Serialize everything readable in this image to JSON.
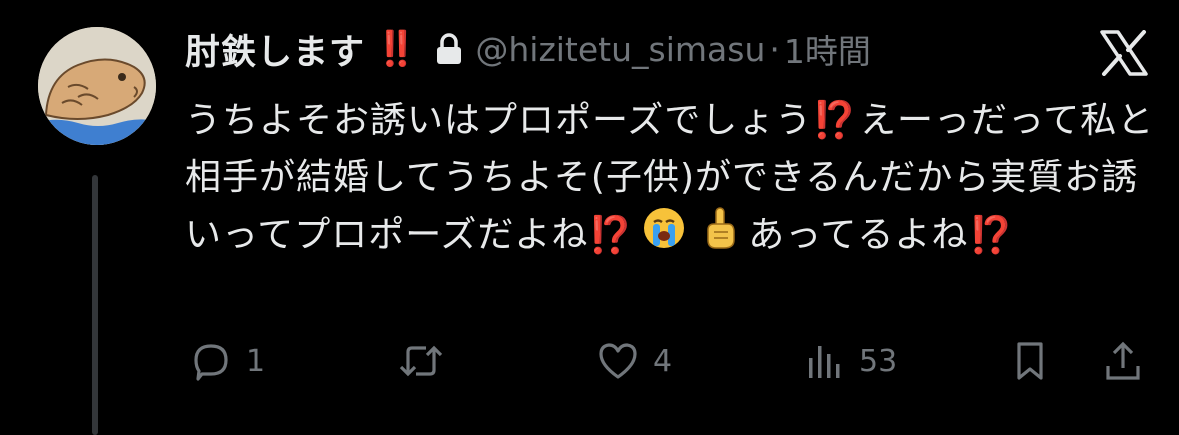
{
  "author": {
    "display_name": "肘鉄します",
    "badge": "‼️",
    "handle": "@hizitetu_simasu",
    "separator": "·",
    "time": "1時間"
  },
  "tweet": {
    "segments": [
      "うちよそお誘いはプロポーズでしょう",
      "⁉️",
      "えーっだって私と相手が結婚してうちよそ(子供)ができるんだから実質お誘いってプロポーズだよね",
      "⁉️",
      "あってるよね",
      "⁉️"
    ],
    "emojis": [
      "loudly-crying-face-emoji",
      "index-pointing-up-emoji"
    ]
  },
  "actions": {
    "reply_count": "1",
    "retweet_count": "",
    "like_count": "4",
    "views_count": "53"
  },
  "icons": {
    "lock": "lock-icon",
    "x_logo": "x-logo-icon",
    "reply": "reply-icon",
    "retweet": "retweet-icon",
    "like": "heart-icon",
    "views": "views-chart-icon",
    "bookmark": "bookmark-icon",
    "share": "share-icon"
  },
  "colors": {
    "background": "#000000",
    "text": "#e7e9ea",
    "secondary": "#71767b",
    "emphasis": "#e0312d",
    "thread_line": "#333639"
  }
}
